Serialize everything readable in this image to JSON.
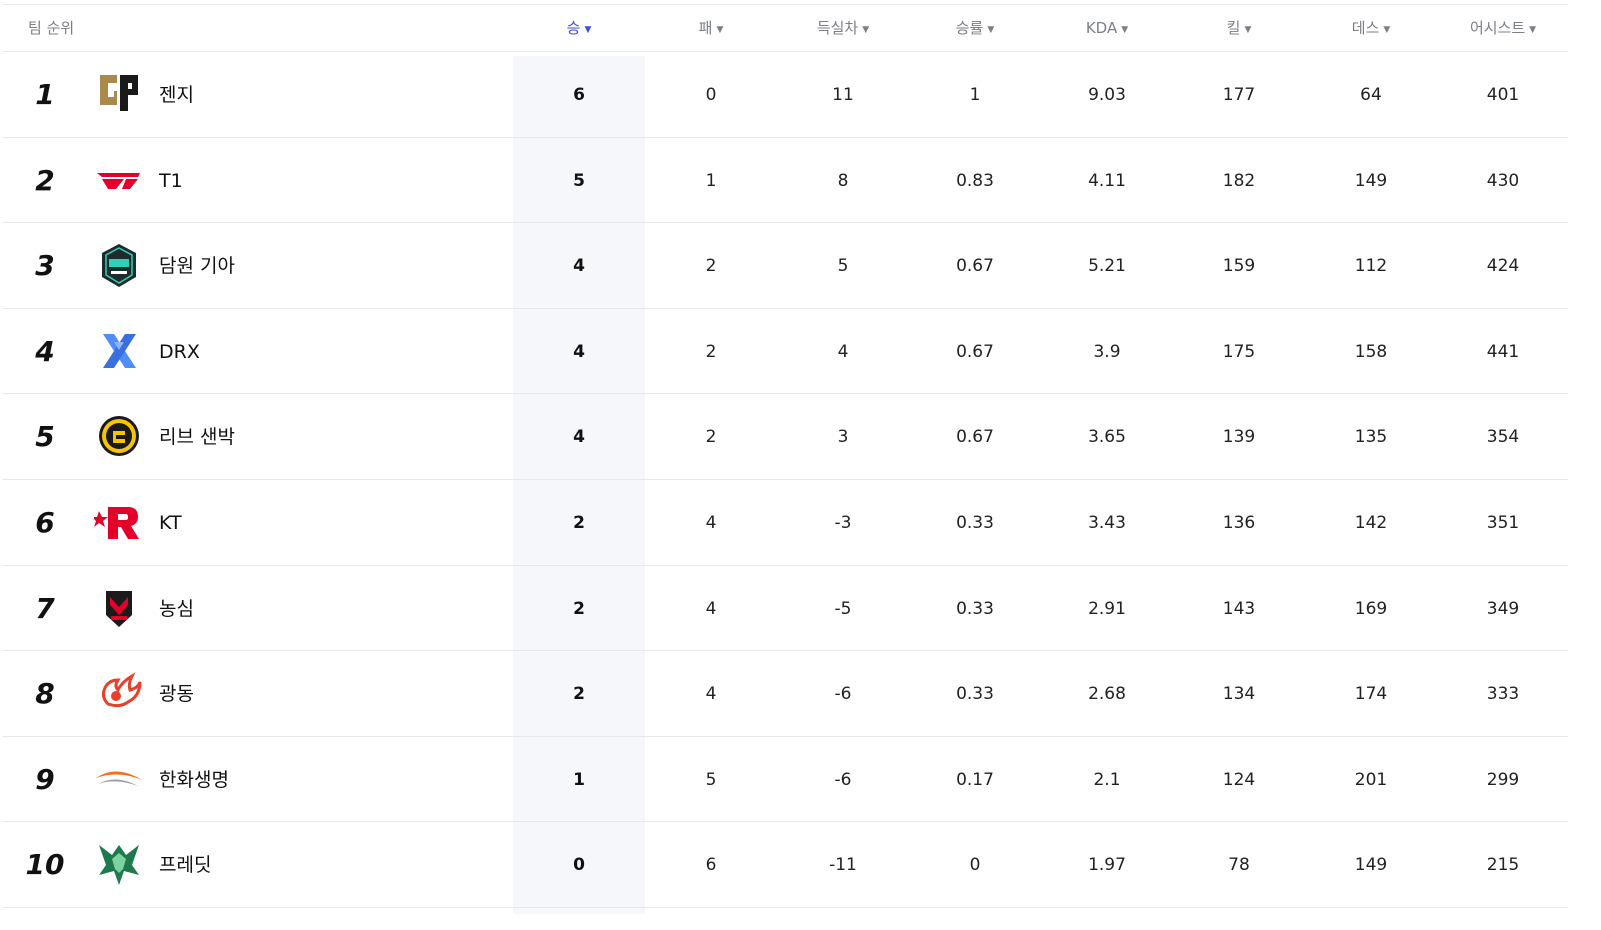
{
  "header": {
    "rank_label": "팀 순위",
    "columns": [
      "승",
      "패",
      "득실차",
      "승률",
      "KDA",
      "킬",
      "데스",
      "어시스트"
    ],
    "active_column": "승",
    "active_color": "#3b4fd8"
  },
  "teams": [
    {
      "rank": "1",
      "name": "젠지",
      "logo": "gen-g-logo",
      "win": "6",
      "loss": "0",
      "diff": "11",
      "rate": "1",
      "kda": "9.03",
      "kill": "177",
      "death": "64",
      "assist": "401"
    },
    {
      "rank": "2",
      "name": "T1",
      "logo": "t1-logo",
      "win": "5",
      "loss": "1",
      "diff": "8",
      "rate": "0.83",
      "kda": "4.11",
      "kill": "182",
      "death": "149",
      "assist": "430"
    },
    {
      "rank": "3",
      "name": "담원 기아",
      "logo": "dwg-kia-logo",
      "win": "4",
      "loss": "2",
      "diff": "5",
      "rate": "0.67",
      "kda": "5.21",
      "kill": "159",
      "death": "112",
      "assist": "424"
    },
    {
      "rank": "4",
      "name": "DRX",
      "logo": "drx-logo",
      "win": "4",
      "loss": "2",
      "diff": "4",
      "rate": "0.67",
      "kda": "3.9",
      "kill": "175",
      "death": "158",
      "assist": "441"
    },
    {
      "rank": "5",
      "name": "리브 샌박",
      "logo": "liiv-sandbox-logo",
      "win": "4",
      "loss": "2",
      "diff": "3",
      "rate": "0.67",
      "kda": "3.65",
      "kill": "139",
      "death": "135",
      "assist": "354"
    },
    {
      "rank": "6",
      "name": "KT",
      "logo": "kt-logo",
      "win": "2",
      "loss": "4",
      "diff": "-3",
      "rate": "0.33",
      "kda": "3.43",
      "kill": "136",
      "death": "142",
      "assist": "351"
    },
    {
      "rank": "7",
      "name": "농심",
      "logo": "nongshim-logo",
      "win": "2",
      "loss": "4",
      "diff": "-5",
      "rate": "0.33",
      "kda": "2.91",
      "kill": "143",
      "death": "169",
      "assist": "349"
    },
    {
      "rank": "8",
      "name": "광동",
      "logo": "kwangdong-logo",
      "win": "2",
      "loss": "4",
      "diff": "-6",
      "rate": "0.33",
      "kda": "2.68",
      "kill": "134",
      "death": "174",
      "assist": "333"
    },
    {
      "rank": "9",
      "name": "한화생명",
      "logo": "hanwha-logo",
      "win": "1",
      "loss": "5",
      "diff": "-6",
      "rate": "0.17",
      "kda": "2.1",
      "kill": "124",
      "death": "201",
      "assist": "299"
    },
    {
      "rank": "10",
      "name": "프레딧",
      "logo": "fredit-logo",
      "win": "0",
      "loss": "6",
      "diff": "-11",
      "rate": "0",
      "kda": "1.97",
      "kill": "78",
      "death": "149",
      "assist": "215"
    }
  ]
}
